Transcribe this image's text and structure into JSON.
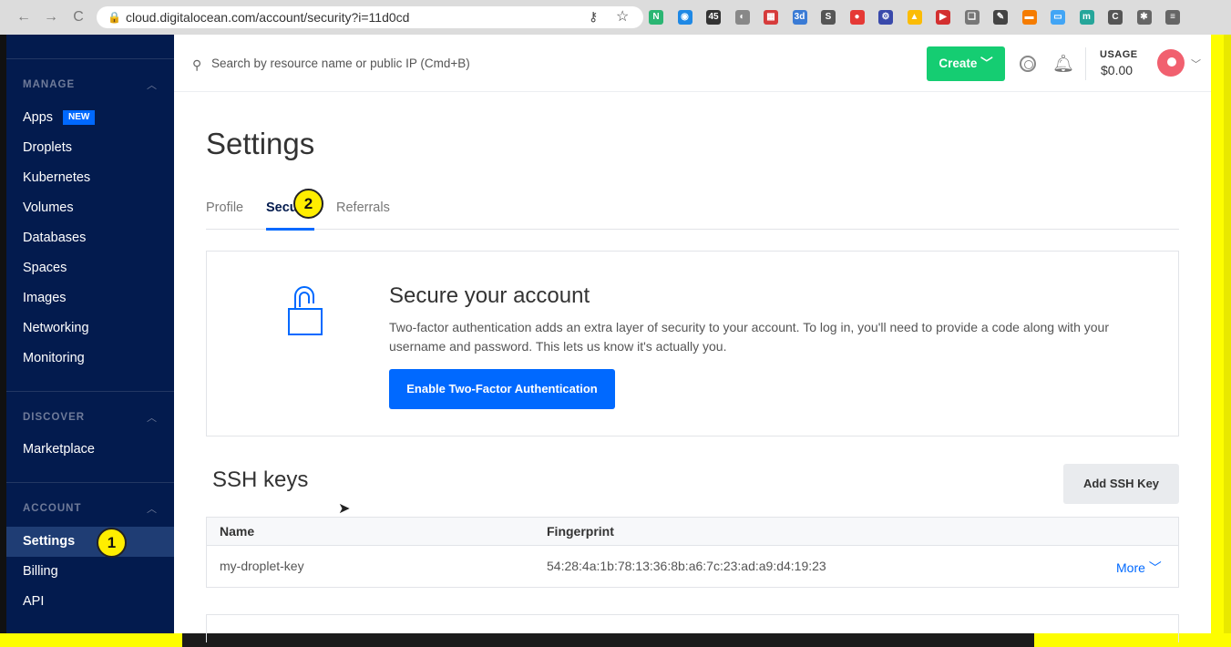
{
  "browser": {
    "url": "cloud.digitalocean.com/account/security?i=11d0cd",
    "nav": {
      "back": "←",
      "forward": "→",
      "reload": "C"
    },
    "extensions": [
      {
        "label": "N",
        "color": "#2bb673"
      },
      {
        "label": "◉",
        "color": "#1e88e5"
      },
      {
        "label": "45",
        "color": "#333333"
      },
      {
        "label": "◐",
        "color": "#888888"
      },
      {
        "label": "▦",
        "color": "#d63b3b"
      },
      {
        "label": "3d",
        "color": "#3a7bd5"
      },
      {
        "label": "S",
        "color": "#555555"
      },
      {
        "label": "●",
        "color": "#e53935"
      },
      {
        "label": "⚙",
        "color": "#3949ab"
      },
      {
        "label": "▲",
        "color": "#fbbc05"
      },
      {
        "label": "▶",
        "color": "#d32f2f"
      },
      {
        "label": "❏",
        "color": "#777777"
      },
      {
        "label": "✎",
        "color": "#444444"
      },
      {
        "label": "▬",
        "color": "#f57c00"
      },
      {
        "label": "▭",
        "color": "#42a5f5"
      },
      {
        "label": "m",
        "color": "#26a69a"
      },
      {
        "label": "C",
        "color": "#555555"
      },
      {
        "label": "✱",
        "color": "#666666"
      },
      {
        "label": "≡",
        "color": "#666666"
      }
    ]
  },
  "sidebar": {
    "sections": [
      {
        "title": "MANAGE",
        "items": [
          "Apps",
          "Droplets",
          "Kubernetes",
          "Volumes",
          "Databases",
          "Spaces",
          "Images",
          "Networking",
          "Monitoring"
        ]
      },
      {
        "title": "DISCOVER",
        "items": [
          "Marketplace"
        ]
      },
      {
        "title": "ACCOUNT",
        "items": [
          "Settings",
          "Billing",
          "API"
        ]
      }
    ],
    "new_badge": "NEW",
    "active_item": "Settings"
  },
  "header": {
    "search_placeholder": "Search by resource name or public IP (Cmd+B)",
    "create_label": "Create",
    "usage_label": "USAGE",
    "usage_value": "$0.00"
  },
  "page": {
    "title": "Settings",
    "tabs": [
      "Profile",
      "Secu",
      "Referrals"
    ],
    "active_tab": "Security"
  },
  "secure_card": {
    "title": "Secure your account",
    "description": "Two-factor authentication adds an extra layer of security to your account. To log in, you'll need to provide a code along with your username and password. This lets us know it's actually you.",
    "button_label": "Enable Two-Factor Authentication"
  },
  "ssh": {
    "title": "SSH keys",
    "add_button": "Add SSH Key",
    "columns": [
      "Name",
      "Fingerprint"
    ],
    "rows": [
      {
        "name": "my-droplet-key",
        "fingerprint": "54:28:4a:1b:78:13:36:8b:a6:7c:23:ad:a9:d4:19:23",
        "action": "More"
      }
    ]
  },
  "annotations": {
    "marker1": "1",
    "marker2": "2"
  },
  "colors": {
    "sidebar": "#031b4e",
    "accent": "#0069ff",
    "create": "#15cd72",
    "highlight": "#ffee00"
  }
}
